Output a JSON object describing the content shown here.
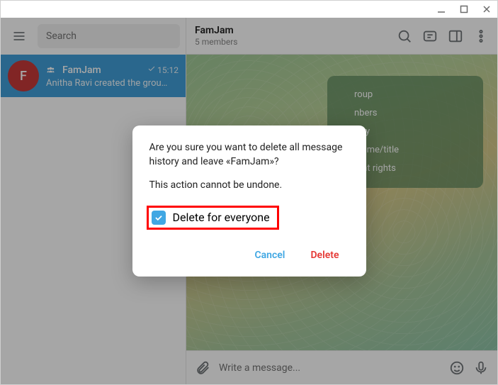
{
  "sidebar": {
    "search_placeholder": "Search",
    "chat": {
      "avatar_letter": "F",
      "name": "FamJam",
      "time": "15:12",
      "preview": "Anitha Ravi created the grou…"
    }
  },
  "header": {
    "title": "FamJam",
    "subtitle": "5 members"
  },
  "group_card": {
    "lines": [
      "roup",
      "",
      "nbers",
      "tory",
      "s t.me/title",
      "rent rights"
    ]
  },
  "composer": {
    "placeholder": "Write a message..."
  },
  "dialog": {
    "line1": "Are you sure you want to delete all message history and leave «FamJam»?",
    "line2": "This action cannot be undone.",
    "checkbox_label": "Delete for everyone",
    "cancel": "Cancel",
    "delete": "Delete"
  }
}
